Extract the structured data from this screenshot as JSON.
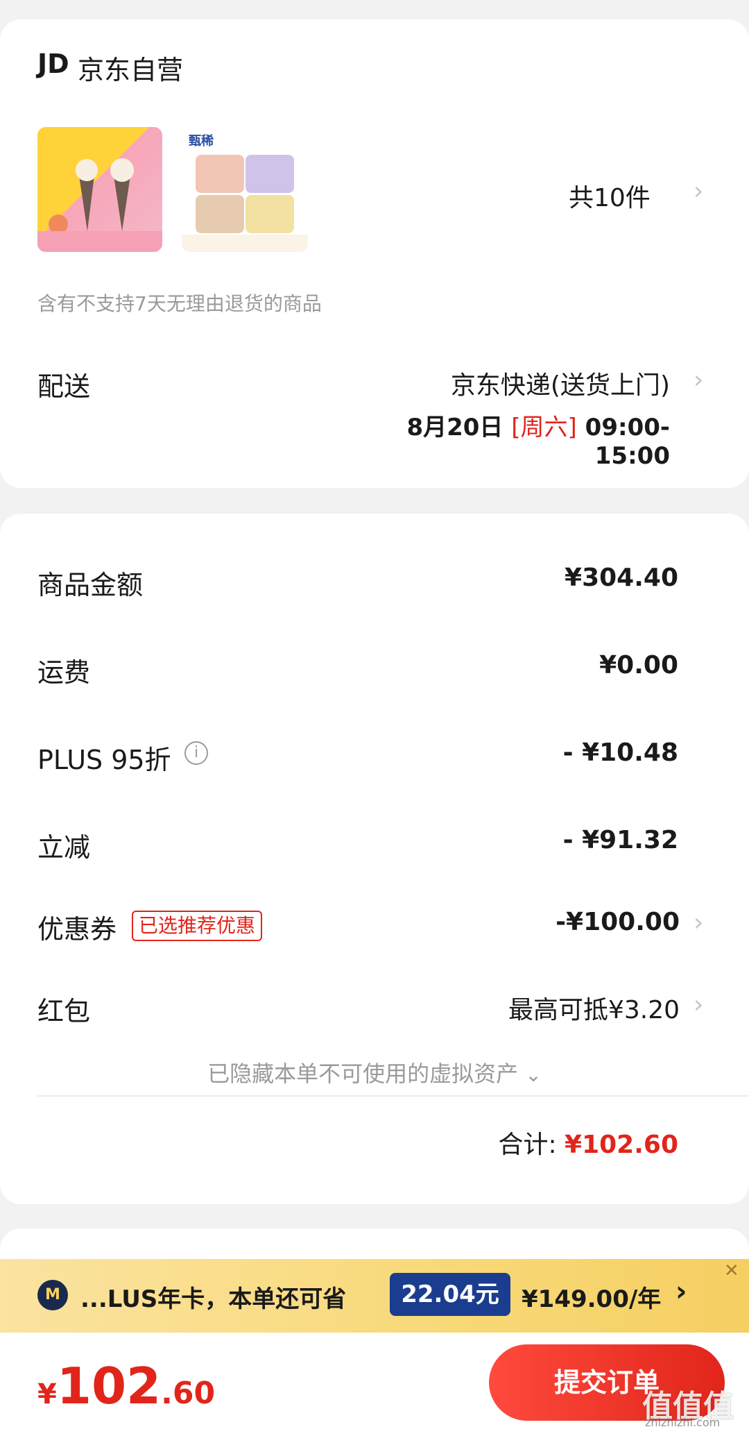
{
  "store": {
    "logo": "JD",
    "name": "京东自营"
  },
  "products": {
    "count": "共10件",
    "notice": "含有不支持7天无理由退货的商品",
    "thumb2_brand": "甄稀"
  },
  "delivery": {
    "label": "配送",
    "method": "京东快递(送货上门)",
    "date": "8月20日",
    "weekday": "[周六]",
    "time": "09:00-15:00"
  },
  "pricing": {
    "items": [
      {
        "label": "商品金额",
        "value": "¥304.40"
      },
      {
        "label": "运费",
        "value": "¥0.00"
      },
      {
        "label": "PLUS 95折",
        "value": "- ¥10.48"
      },
      {
        "label": "立减",
        "value": "- ¥91.32"
      },
      {
        "label": "优惠券",
        "tag": "已选推荐优惠",
        "value": "-¥100.00"
      },
      {
        "label": "红包",
        "value": "最高可抵¥3.20"
      }
    ],
    "hidden_assets": "已隐藏本单不可使用的虚拟资产",
    "total_label": "合计:",
    "total_value": "¥102.60"
  },
  "plus_banner": {
    "text": "...LUS年卡，本单还可省",
    "save": "22.04元",
    "price": "¥149.00/年"
  },
  "footer": {
    "price_symbol": "¥",
    "price_int": "102",
    "price_dec": ".60",
    "submit_label": "提交订单",
    "watermark": "值值值",
    "watermark_url": "zhizhizhi.com"
  },
  "colors": {
    "accent": "#e1251b",
    "banner": "#f8d978",
    "save_badge": "#1b3d8f"
  }
}
